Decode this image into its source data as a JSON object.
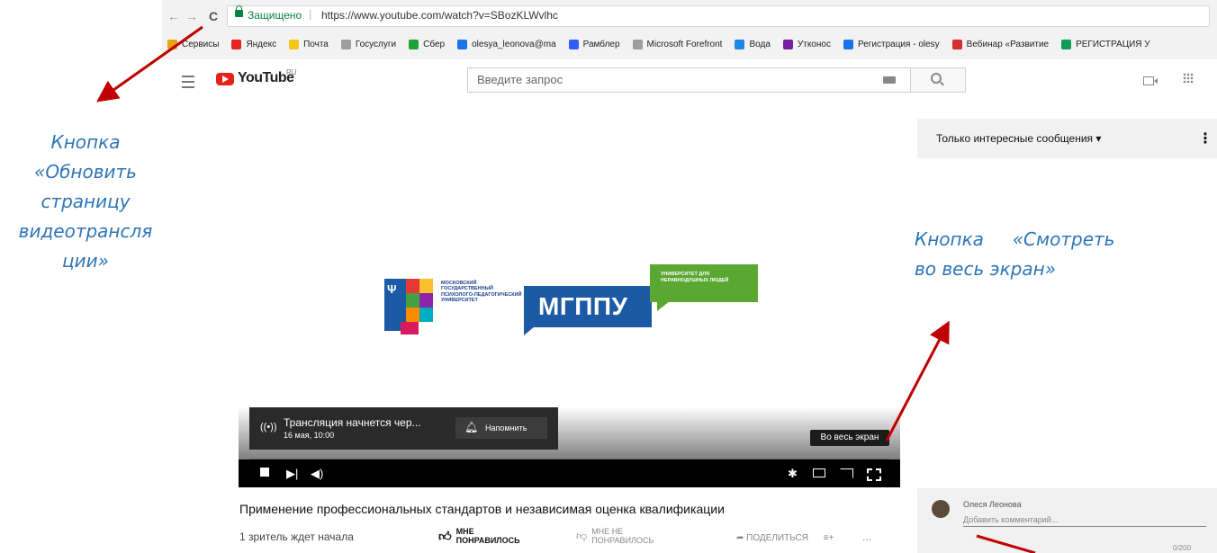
{
  "browser": {
    "back": "←",
    "forward": "→",
    "reload": "C",
    "secure_label": "Защищено",
    "separator": "|",
    "url": "https://www.youtube.com/watch?v=SBozKLWvlhc",
    "bookmarks": [
      {
        "label": "Сервисы",
        "color": "#e8a317"
      },
      {
        "label": "Яндекс",
        "color": "#e52620"
      },
      {
        "label": "Почта",
        "color": "#f5c518"
      },
      {
        "label": "Госуслуги",
        "color": "#9e9e9e"
      },
      {
        "label": "Сбер",
        "color": "#21a038"
      },
      {
        "label": "olesya_leonova@ma",
        "color": "#1a73e8"
      },
      {
        "label": "Рамблер",
        "color": "#315efb"
      },
      {
        "label": "Microsoft Forefront",
        "color": "#9e9e9e"
      },
      {
        "label": "Вода",
        "color": "#1e88e5"
      },
      {
        "label": "Утконос",
        "color": "#7b1fa2"
      },
      {
        "label": "Регистрация - olesy",
        "color": "#1a73e8"
      },
      {
        "label": "Вебинар «Развитие",
        "color": "#d32f2f"
      },
      {
        "label": "РЕГИСТРАЦИЯ У",
        "color": "#0f9d58"
      }
    ]
  },
  "youtube": {
    "logo_text": "YouTube",
    "region": "RU",
    "search_placeholder": "Введите запрос"
  },
  "player": {
    "logo": {
      "university_text": "МОСКОВСКИЙ ГОСУДАРСТВЕННЫЙ ПСИХОЛОГО-ПЕДАГОГИЧЕСКИЙ УНИВЕРСИТЕТ",
      "acronym": "МГППУ",
      "tagline": "УНИВЕРСИТЕТ ДЛЯ НЕРАВНОДУШНЫХ ЛЮДЕЙ"
    },
    "live_card": {
      "icon": "((•))",
      "title": "Трансляция начнется чер...",
      "date": "16 мая, 10:00",
      "remind_label": "Напомнить"
    },
    "tooltip": "Во весь экран"
  },
  "video": {
    "title": "Применение профессиональных стандартов и независимая оценка квалификации",
    "viewers": "1 зритель ждет начала",
    "like_label": "МНЕ ПОНРАВИЛОСЬ",
    "dislike_label": "МНЕ НЕ ПОНРАВИЛОСЬ",
    "share_label": "ПОДЕЛИТЬСЯ",
    "more": "..."
  },
  "chat": {
    "filter": "Только интересные сообщения",
    "user": "Олеся Леонова",
    "placeholder": "Добавить комментарий...",
    "counter": "0/200"
  },
  "annotations": {
    "left_lines": [
      "Кнопка",
      "«Обновить",
      "страницу",
      "видеотрансля",
      "ции»"
    ],
    "right_lines": [
      "Кнопка     «Смотреть",
      "во весь экран»"
    ],
    "arrow_color": "#c00000"
  }
}
